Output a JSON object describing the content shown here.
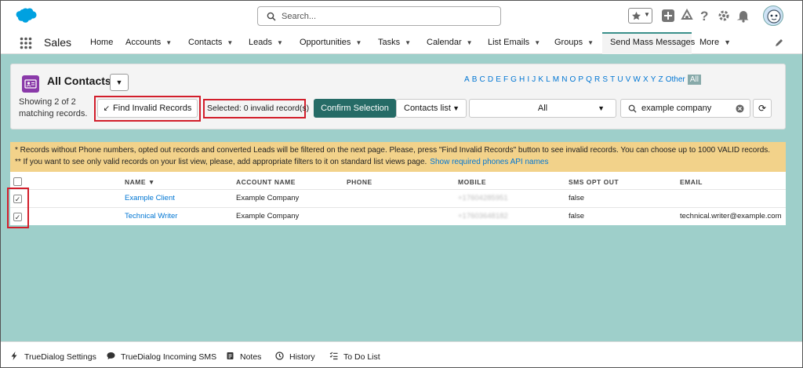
{
  "header": {
    "search_placeholder": "Search...",
    "icons": [
      "favorites-star-icon",
      "add-icon",
      "trailhead-icon",
      "help-icon",
      "setup-gear-icon",
      "notifications-bell-icon",
      "user-avatar"
    ]
  },
  "nav": {
    "app_name": "Sales",
    "items": [
      {
        "label": "Home",
        "dropdown": false
      },
      {
        "label": "Accounts",
        "dropdown": true
      },
      {
        "label": "Contacts",
        "dropdown": true
      },
      {
        "label": "Leads",
        "dropdown": true
      },
      {
        "label": "Opportunities",
        "dropdown": true
      },
      {
        "label": "Tasks",
        "dropdown": true
      },
      {
        "label": "Calendar",
        "dropdown": true
      },
      {
        "label": "List Emails",
        "dropdown": true
      },
      {
        "label": "Groups",
        "dropdown": true
      },
      {
        "label": "Send Mass Messages",
        "dropdown": false,
        "active": true
      },
      {
        "label": "More",
        "dropdown": true
      }
    ]
  },
  "list": {
    "title": "All Contacts",
    "showing_line1": "Showing 2 of 2",
    "showing_line2": "matching records.",
    "find_invalid": "Find Invalid Records",
    "selected_status": "Selected: 0 invalid record(s)",
    "confirm": "Confirm Selection",
    "list_type": "Contacts list",
    "view_filter": "All",
    "search_value": "example company",
    "alphabet": [
      "A",
      "B",
      "C",
      "D",
      "E",
      "F",
      "G",
      "H",
      "I",
      "J",
      "K",
      "L",
      "M",
      "N",
      "O",
      "P",
      "Q",
      "R",
      "S",
      "T",
      "U",
      "V",
      "W",
      "X",
      "Y",
      "Z",
      "Other",
      "All"
    ]
  },
  "notice": {
    "line1": "* Records without Phone numbers, opted out records and converted Leads will be filtered on the next page. Please, press \"Find Invalid Records\" button to see invalid records. You can choose up to 1000 VALID records.",
    "line2": "** If you want to see only valid records on your list view, please, add appropriate filters to it on standard list views page.",
    "link": "Show required phones API names"
  },
  "table": {
    "columns": [
      "NAME ▼",
      "ACCOUNT NAME",
      "PHONE",
      "MOBILE",
      "SMS OPT OUT",
      "EMAIL"
    ],
    "rows": [
      {
        "name": "Example Client",
        "account": "Example Company",
        "phone": "",
        "mobile": "+17604285951",
        "sms_opt_out": "false",
        "email": "",
        "checked": true
      },
      {
        "name": "Technical Writer",
        "account": "Example Company",
        "phone": "",
        "mobile": "+17603648182",
        "sms_opt_out": "false",
        "email": "technical.writer@example.com",
        "checked": true
      }
    ]
  },
  "footer": {
    "items": [
      "TrueDialog Settings",
      "TrueDialog Incoming SMS",
      "Notes",
      "History",
      "To Do List"
    ]
  },
  "colors": {
    "brand": "#00a1e0",
    "teal_bg": "#9ecfca",
    "confirm_btn": "#256b66",
    "highlight": "#d21e2b",
    "notice_bg": "#f2d28a",
    "link": "#0176d3"
  }
}
